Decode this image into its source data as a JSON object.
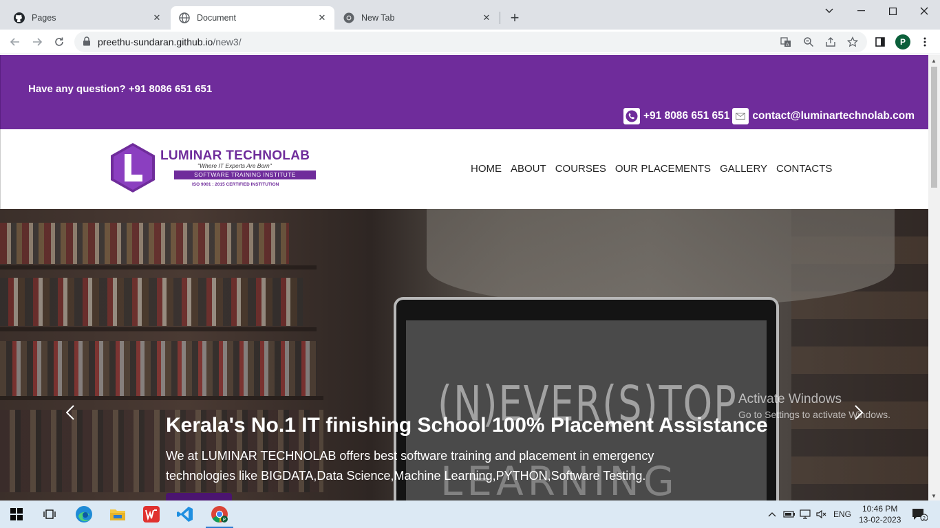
{
  "browser": {
    "tabs": [
      {
        "title": "Pages",
        "icon": "github-icon"
      },
      {
        "title": "Document",
        "icon": "globe-icon",
        "active": true
      },
      {
        "title": "New Tab",
        "icon": "chrome-icon"
      }
    ],
    "url_host": "preethu-sundaran.github.io",
    "url_path": "/new3/",
    "profile_initial": "P"
  },
  "topbar": {
    "question": "Have any question? +91 8086 651 651",
    "phone": "+91 8086 651 651",
    "email": "contact@luminartechnolab.com"
  },
  "logo": {
    "name": "LUMINAR TECHNOLAB",
    "tagline": "\"Where IT Experts Are Born\"",
    "band": "SOFTWARE TRAINING INSTITUTE",
    "iso": "ISO 9001 : 2015 CERTIFIED INSTITUTION"
  },
  "nav": [
    "HOME",
    "ABOUT",
    "COURSES",
    "OUR PLACEMENTS",
    "GALLERY",
    "CONTACTS"
  ],
  "hero": {
    "title": "Kerala's No.1 IT finishing School 100% Placement Assistance",
    "description": "We at LUMINAR TECHNOLAB offers best software training and placement in emergency technologies like BIGDATA,Data Science,Machine Learning,PYTHON,Software Testing.",
    "chalk_line1": "(N)EVER(S)TOP",
    "chalk_line2": "LEARNING"
  },
  "watermark": {
    "line1": "Activate Windows",
    "line2": "Go to Settings to activate Windows."
  },
  "taskbar": {
    "lang": "ENG",
    "time": "10:46 PM",
    "date": "13-02-2023",
    "notifications": "2"
  },
  "colors": {
    "brand_purple": "#6f2c9b",
    "taskbar": "#dce9f4"
  }
}
